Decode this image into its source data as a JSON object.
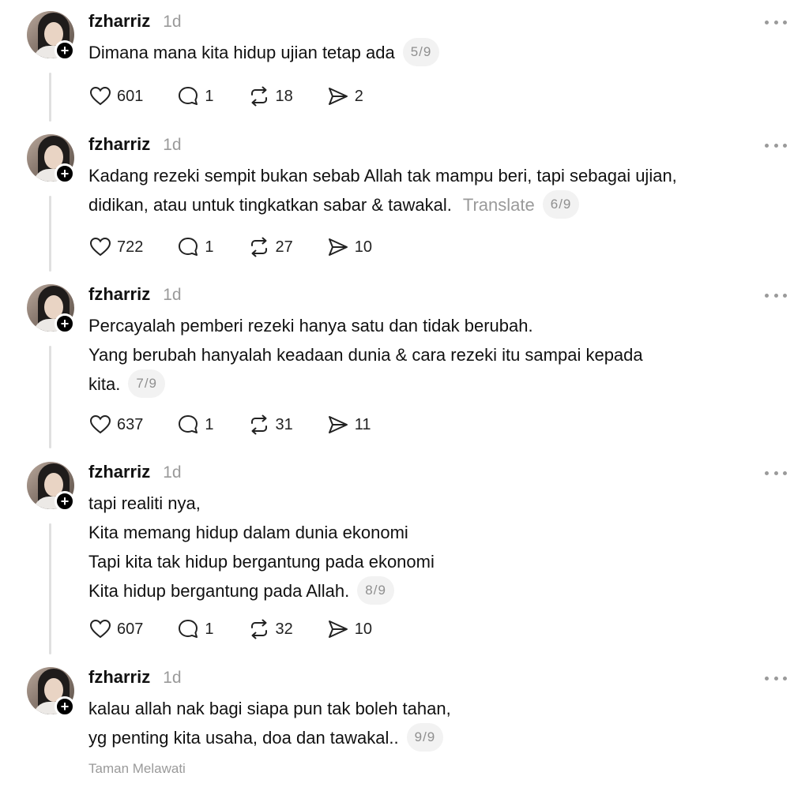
{
  "posts": [
    {
      "username": "fzharriz",
      "time": "1d",
      "lines": [
        "Dimana mana kita hidup ujian tetap ada"
      ],
      "translate": "",
      "page": "5/9",
      "likes": "601",
      "replies": "1",
      "reposts": "18",
      "shares": "2"
    },
    {
      "username": "fzharriz",
      "time": "1d",
      "lines": [
        "Kadang rezeki sempit bukan sebab Allah tak mampu beri, tapi sebagai ujian,",
        "didikan, atau untuk tingkatkan sabar & tawakal."
      ],
      "translate": "Translate",
      "page": "6/9",
      "likes": "722",
      "replies": "1",
      "reposts": "27",
      "shares": "10"
    },
    {
      "username": "fzharriz",
      "time": "1d",
      "lines": [
        "Percayalah pemberi rezeki hanya satu dan tidak berubah.",
        "Yang berubah hanyalah keadaan dunia & cara rezeki itu sampai kepada",
        "kita."
      ],
      "translate": "",
      "page": "7/9",
      "likes": "637",
      "replies": "1",
      "reposts": "31",
      "shares": "11"
    },
    {
      "username": "fzharriz",
      "time": "1d",
      "lines": [
        "tapi realiti nya,",
        "Kita memang hidup dalam dunia ekonomi",
        "Tapi kita tak hidup bergantung pada ekonomi",
        "Kita hidup bergantung pada Allah."
      ],
      "translate": "",
      "page": "8/9",
      "likes": "607",
      "replies": "1",
      "reposts": "32",
      "shares": "10"
    },
    {
      "username": "fzharriz",
      "time": "1d",
      "lines": [
        "kalau allah nak bagi siapa pun tak boleh tahan,",
        "yg penting kita usaha, doa dan tawakal.."
      ],
      "translate": "",
      "page": "9/9"
    }
  ],
  "location": "Taman Melawati",
  "icons": {
    "like": "heart-icon",
    "reply": "comment-icon",
    "repost": "repost-icon",
    "share": "send-icon",
    "more": "more-icon",
    "follow": "plus-icon"
  },
  "colors": {
    "text": "#111111",
    "muted": "#9a9a9a",
    "pill_bg": "#f2f2f2",
    "thread_line": "#e0e0e0"
  }
}
